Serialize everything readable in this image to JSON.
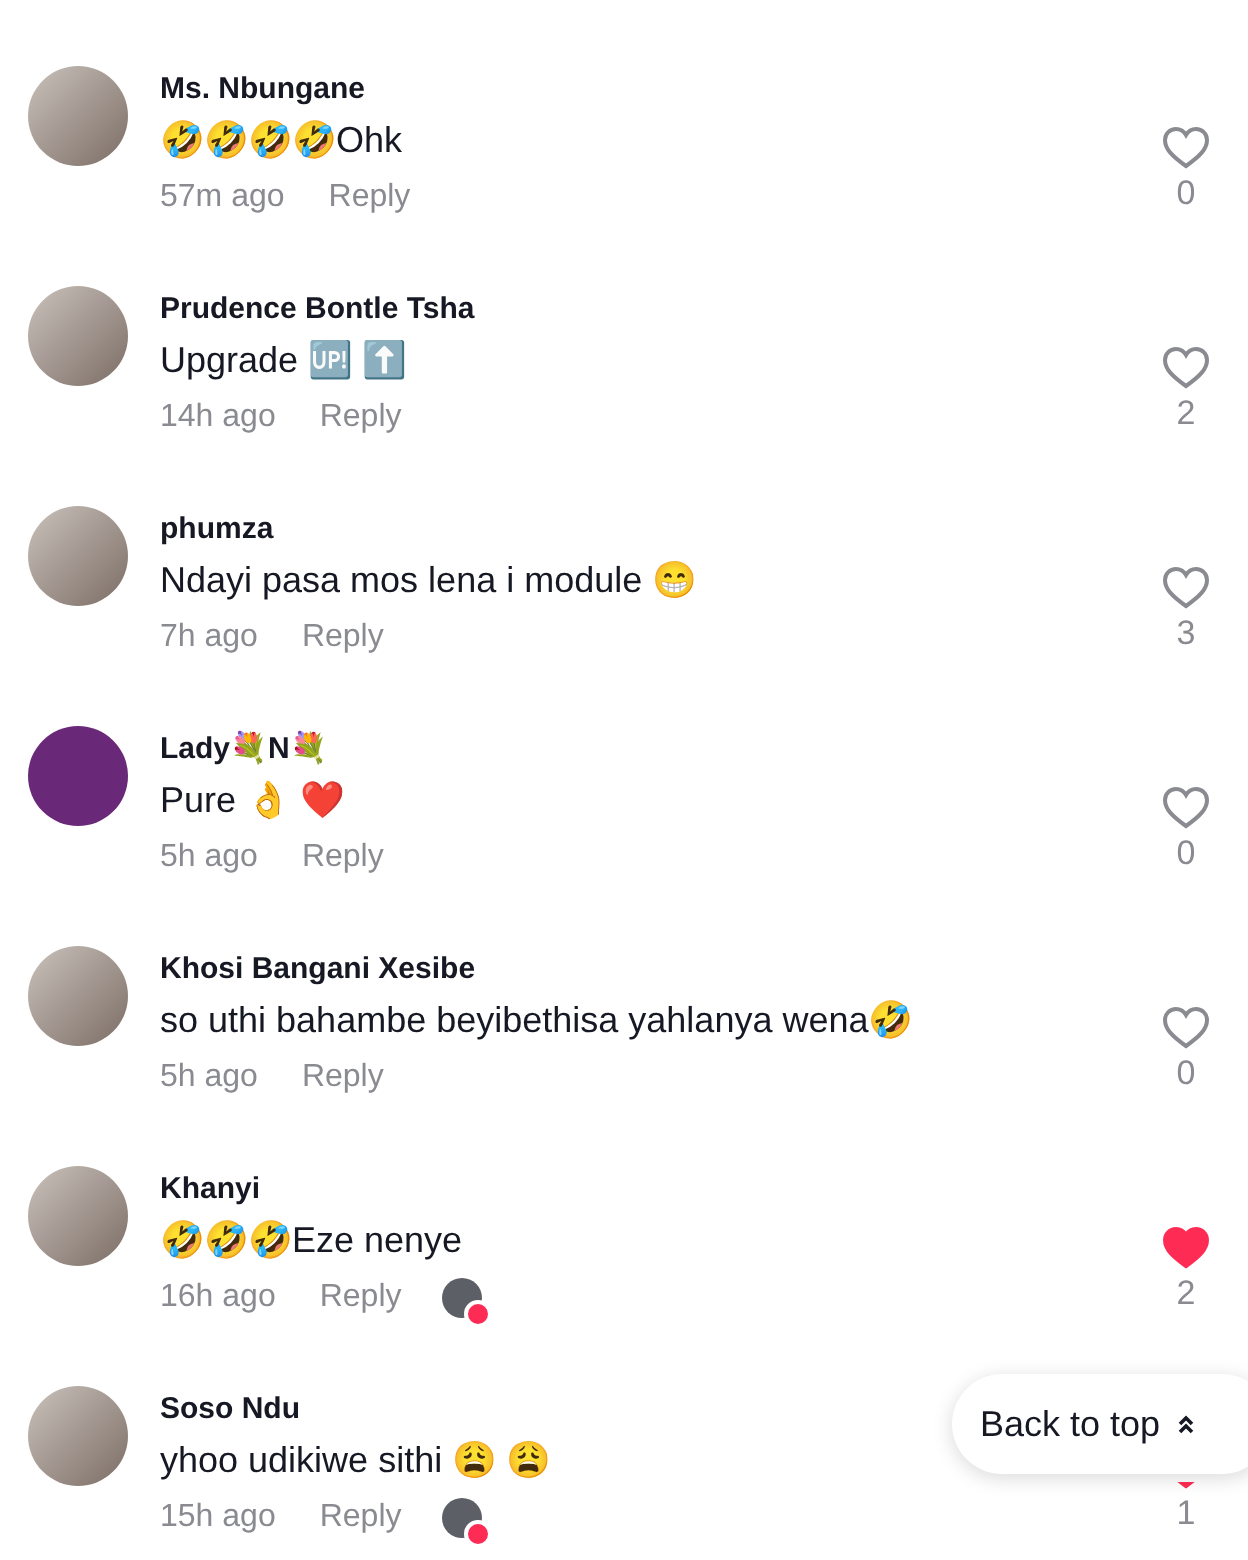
{
  "comments": [
    {
      "author": "Ms. Nbungane",
      "text": "🤣🤣🤣🤣Ohk",
      "time": "57m ago",
      "reply": "Reply",
      "liked": false,
      "likes": "0",
      "creator_liked": false,
      "kind": "photo"
    },
    {
      "author": "Prudence Bontle Tsha",
      "text": "Upgrade 🆙 ⬆️",
      "time": "14h ago",
      "reply": "Reply",
      "liked": false,
      "likes": "2",
      "creator_liked": false,
      "kind": "photo"
    },
    {
      "author": "phumza",
      "text": "Ndayi pasa mos lena i module 😁",
      "time": "7h ago",
      "reply": "Reply",
      "liked": false,
      "likes": "3",
      "creator_liked": false,
      "kind": "photo"
    },
    {
      "author": "Lady💐N💐",
      "text": "Pure 👌 ❤️",
      "time": "5h ago",
      "reply": "Reply",
      "liked": false,
      "likes": "0",
      "creator_liked": false,
      "kind": "plain",
      "color": "#6a2878"
    },
    {
      "author": "Khosi Bangani Xesibe",
      "text": "so uthi bahambe beyibethisa yahlanya wena🤣",
      "time": "5h ago",
      "reply": "Reply",
      "liked": false,
      "likes": "0",
      "creator_liked": false,
      "kind": "photo"
    },
    {
      "author": "Khanyi",
      "text": "🤣🤣🤣Eze nenye",
      "time": "16h ago",
      "reply": "Reply",
      "liked": true,
      "likes": "2",
      "creator_liked": true,
      "kind": "photo"
    },
    {
      "author": "Soso Ndu",
      "text": "yhoo udikiwe sithi 😩 😩",
      "time": "15h ago",
      "reply": "Reply",
      "liked": true,
      "likes": "1",
      "creator_liked": true,
      "kind": "photo"
    }
  ],
  "back_to_top": {
    "label": "Back to top"
  }
}
